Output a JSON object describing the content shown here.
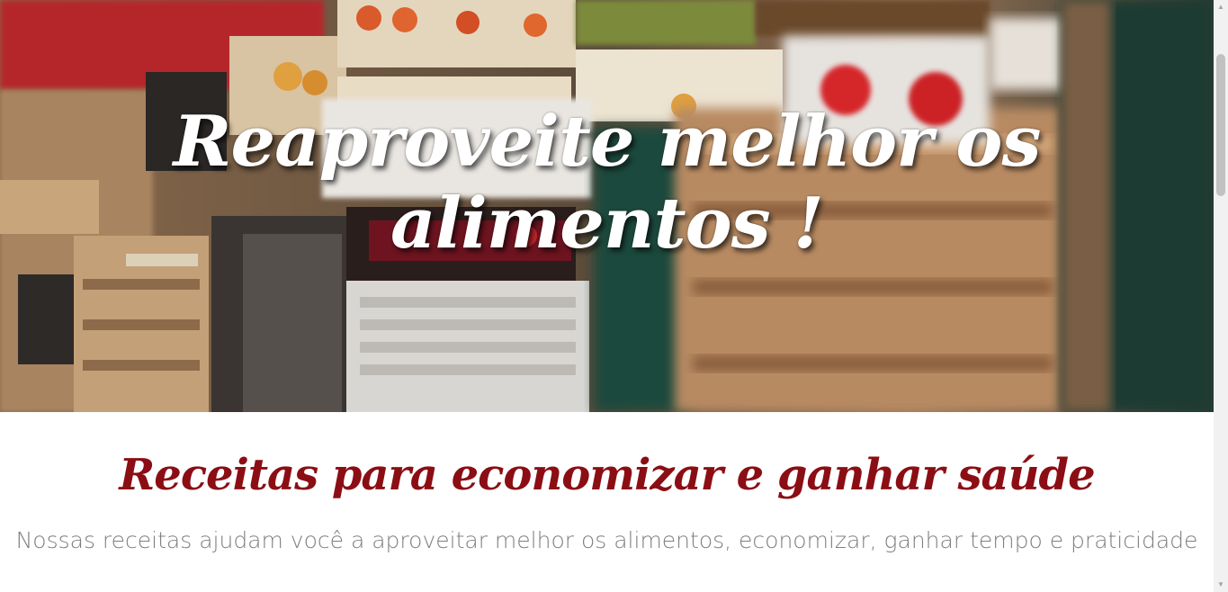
{
  "hero": {
    "title": "Reaproveite melhor os alimentos !",
    "image_description_icon": "market-crates-image"
  },
  "section": {
    "title": "Receitas para economizar e ganhar saúde",
    "subtitle": "Nossas receitas ajudam você a aproveitar melhor os alimentos, economizar, ganhar tempo e praticidade"
  },
  "colors": {
    "title_red": "#8b0e14",
    "subtitle_gray": "#7f7f7f",
    "hero_text": "#ffffff"
  },
  "scrollbar": {
    "up_icon": "scroll-up-arrow-icon",
    "down_icon": "scroll-down-arrow-icon"
  }
}
